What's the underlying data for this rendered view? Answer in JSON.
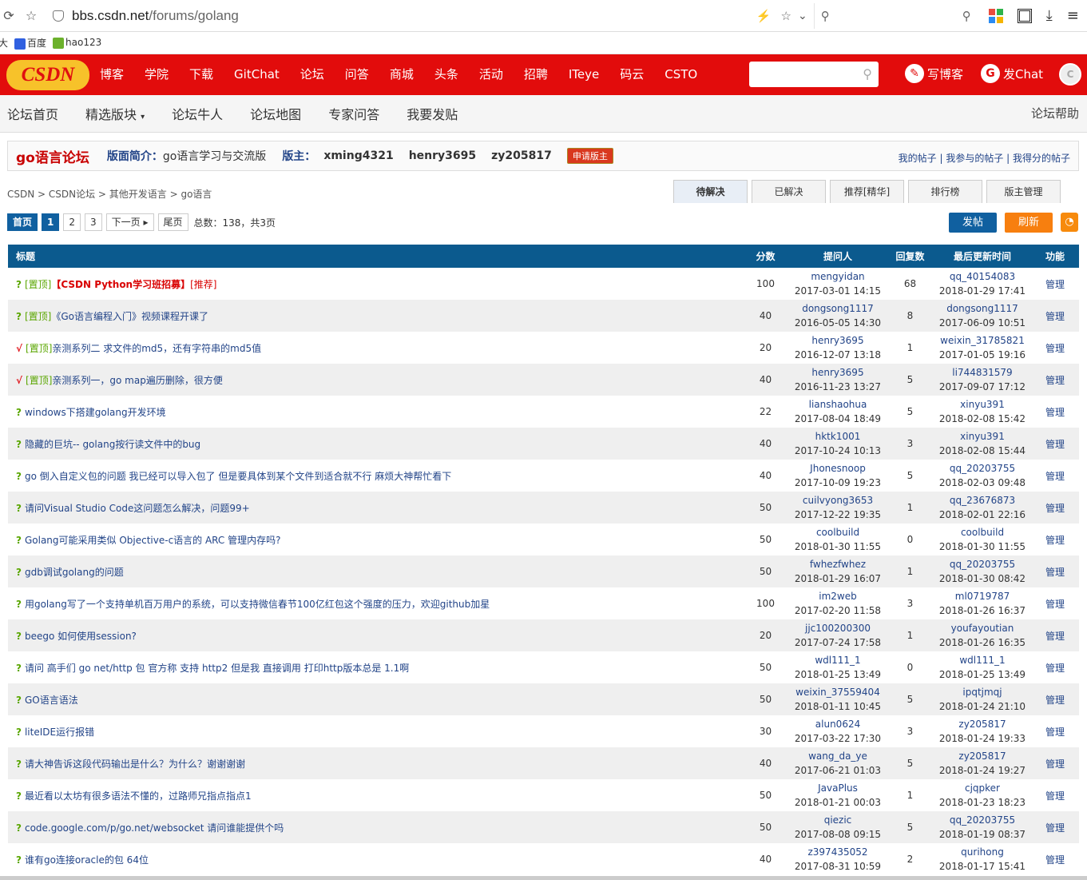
{
  "browser": {
    "url_host": "bbs.csdn.net",
    "url_path": "/forums/golang"
  },
  "bookmarks": [
    {
      "label": "网大"
    },
    {
      "label": "百度"
    },
    {
      "label": "hao123"
    }
  ],
  "topbar": {
    "logo": "CSDN",
    "nav": [
      "博客",
      "学院",
      "下载",
      "GitChat",
      "论坛",
      "问答",
      "商城",
      "头条",
      "活动",
      "招聘",
      "ITeye",
      "码云",
      "CSTO"
    ],
    "write": "写博客",
    "chat": "发Chat"
  },
  "forumnav": {
    "items": [
      "论坛首页",
      "精选版块",
      "论坛牛人",
      "论坛地图",
      "专家问答",
      "我要发贴"
    ],
    "help": "论坛帮助"
  },
  "info": {
    "title": "go语言论坛",
    "intro_label": "版面简介：",
    "intro": "go语言学习与交流版",
    "mod_label": "版主：",
    "mods": [
      "xming4321",
      "henry3695",
      "zy205817"
    ],
    "apply": "申请版主",
    "links": "我的帖子 | 我参与的帖子 | 我得分的帖子"
  },
  "breadcrumb": "CSDN > CSDN论坛 > 其他开发语言 > go语言",
  "tabs": [
    "待解决",
    "已解决",
    "推荐[精华]",
    "排行榜",
    "版主管理"
  ],
  "pager": {
    "home": "首页",
    "pages": [
      "1",
      "2",
      "3"
    ],
    "next": "下一页 ▸",
    "last": "尾页",
    "total": "总数：138，共3页"
  },
  "buttons": {
    "post": "发帖",
    "refresh": "刷新",
    "rss": "RSS"
  },
  "table": {
    "headers": [
      "标题",
      "分数",
      "提问人",
      "回复数",
      "最后更新时间",
      "功能"
    ],
    "rows": [
      {
        "mark": "?",
        "top": "[置顶]",
        "title": "【CSDN Python学习班招募】",
        "rec": "[推荐]",
        "score": "100",
        "asker": "mengyidan",
        "ask_time": "2017-03-01 14:15",
        "replies": "68",
        "last_user": "qq_40154083",
        "last_time": "2018-01-29 17:41",
        "action": "管理"
      },
      {
        "mark": "?",
        "top": "[置顶]",
        "title": "《Go语言编程入门》视频课程开课了",
        "rec": "",
        "score": "40",
        "asker": "dongsong1117",
        "ask_time": "2016-05-05 14:30",
        "replies": "8",
        "last_user": "dongsong1117",
        "last_time": "2017-06-09 10:51",
        "action": "管理"
      },
      {
        "mark": "√",
        "top": "[置顶]",
        "title": "亲测系列二 求文件的md5，还有字符串的md5值",
        "rec": "",
        "score": "20",
        "asker": "henry3695",
        "ask_time": "2016-12-07 13:18",
        "replies": "1",
        "last_user": "weixin_31785821",
        "last_time": "2017-01-05 19:16",
        "action": "管理"
      },
      {
        "mark": "√",
        "top": "[置顶]",
        "title": "亲测系列一，go map遍历删除，很方便",
        "rec": "",
        "score": "40",
        "asker": "henry3695",
        "ask_time": "2016-11-23 13:27",
        "replies": "5",
        "last_user": "li744831579",
        "last_time": "2017-09-07 17:12",
        "action": "管理"
      },
      {
        "mark": "?",
        "top": "",
        "title": "windows下搭建golang开发环境",
        "rec": "",
        "score": "22",
        "asker": "lianshaohua",
        "ask_time": "2017-08-04 18:49",
        "replies": "5",
        "last_user": "xinyu391",
        "last_time": "2018-02-08 15:42",
        "action": "管理"
      },
      {
        "mark": "?",
        "top": "",
        "title": "隐藏的巨坑-- golang按行读文件中的bug",
        "rec": "",
        "score": "40",
        "asker": "hktk1001",
        "ask_time": "2017-10-24 10:13",
        "replies": "3",
        "last_user": "xinyu391",
        "last_time": "2018-02-08 15:44",
        "action": "管理"
      },
      {
        "mark": "?",
        "top": "",
        "title": "go 倒入自定义包的问题 我已经可以导入包了 但是要具体到某个文件到适合就不行 麻烦大神帮忙看下",
        "rec": "",
        "score": "40",
        "asker": "Jhonesnoop",
        "ask_time": "2017-10-09 19:23",
        "replies": "5",
        "last_user": "qq_20203755",
        "last_time": "2018-02-03 09:48",
        "action": "管理"
      },
      {
        "mark": "?",
        "top": "",
        "title": "请问Visual Studio Code这问题怎么解决，问题99+",
        "rec": "",
        "score": "50",
        "asker": "cuilvyong3653",
        "ask_time": "2017-12-22 19:35",
        "replies": "1",
        "last_user": "qq_23676873",
        "last_time": "2018-02-01 22:16",
        "action": "管理"
      },
      {
        "mark": "?",
        "top": "",
        "title": "Golang可能采用类似 Objective-c语言的 ARC 管理内存吗?",
        "rec": "",
        "score": "50",
        "asker": "coolbuild",
        "ask_time": "2018-01-30 11:55",
        "replies": "0",
        "last_user": "coolbuild",
        "last_time": "2018-01-30 11:55",
        "action": "管理"
      },
      {
        "mark": "?",
        "top": "",
        "title": "gdb调试golang的问题",
        "rec": "",
        "score": "50",
        "asker": "fwhezfwhez",
        "ask_time": "2018-01-29 16:07",
        "replies": "1",
        "last_user": "qq_20203755",
        "last_time": "2018-01-30 08:42",
        "action": "管理"
      },
      {
        "mark": "?",
        "top": "",
        "title": "用golang写了一个支持单机百万用户的系统，可以支持微信春节100亿红包这个强度的压力，欢迎github加星",
        "rec": "",
        "score": "100",
        "asker": "im2web",
        "ask_time": "2017-02-20 11:58",
        "replies": "3",
        "last_user": "ml0719787",
        "last_time": "2018-01-26 16:37",
        "action": "管理"
      },
      {
        "mark": "?",
        "top": "",
        "title": "beego 如何使用session?",
        "rec": "",
        "score": "20",
        "asker": "jjc100200300",
        "ask_time": "2017-07-24 17:58",
        "replies": "1",
        "last_user": "youfayoutian",
        "last_time": "2018-01-26 16:35",
        "action": "管理"
      },
      {
        "mark": "?",
        "top": "",
        "title": "请问 高手们 go net/http 包 官方称 支持 http2 但是我 直接调用 打印http版本总是 1.1啊",
        "rec": "",
        "score": "50",
        "asker": "wdl111_1",
        "ask_time": "2018-01-25 13:49",
        "replies": "0",
        "last_user": "wdl111_1",
        "last_time": "2018-01-25 13:49",
        "action": "管理"
      },
      {
        "mark": "?",
        "top": "",
        "title": "GO语言语法",
        "rec": "",
        "score": "50",
        "asker": "weixin_37559404",
        "ask_time": "2018-01-11 10:45",
        "replies": "5",
        "last_user": "ipqtjmqj",
        "last_time": "2018-01-24 21:10",
        "action": "管理"
      },
      {
        "mark": "?",
        "top": "",
        "title": "liteIDE运行报错",
        "rec": "",
        "score": "30",
        "asker": "alun0624",
        "ask_time": "2017-03-22 17:30",
        "replies": "3",
        "last_user": "zy205817",
        "last_time": "2018-01-24 19:33",
        "action": "管理"
      },
      {
        "mark": "?",
        "top": "",
        "title": "请大神告诉这段代码输出是什么？为什么？谢谢谢谢",
        "rec": "",
        "score": "40",
        "asker": "wang_da_ye",
        "ask_time": "2017-06-21 01:03",
        "replies": "5",
        "last_user": "zy205817",
        "last_time": "2018-01-24 19:27",
        "action": "管理"
      },
      {
        "mark": "?",
        "top": "",
        "title": "最近看以太坊有很多语法不懂的，过路师兄指点指点1",
        "rec": "",
        "score": "50",
        "asker": "JavaPlus",
        "ask_time": "2018-01-21 00:03",
        "replies": "1",
        "last_user": "cjqpker",
        "last_time": "2018-01-23 18:23",
        "action": "管理"
      },
      {
        "mark": "?",
        "top": "",
        "title": "code.google.com/p/go.net/websocket 请问谁能提供个吗",
        "rec": "",
        "score": "50",
        "asker": "qiezic",
        "ask_time": "2017-08-08 09:15",
        "replies": "5",
        "last_user": "qq_20203755",
        "last_time": "2018-01-19 08:37",
        "action": "管理"
      },
      {
        "mark": "?",
        "top": "",
        "title": "谁有go连接oracle的包 64位",
        "rec": "",
        "score": "40",
        "asker": "z397435052",
        "ask_time": "2017-08-31 10:59",
        "replies": "2",
        "last_user": "qurihong",
        "last_time": "2018-01-17 15:41",
        "action": "管理"
      }
    ]
  }
}
